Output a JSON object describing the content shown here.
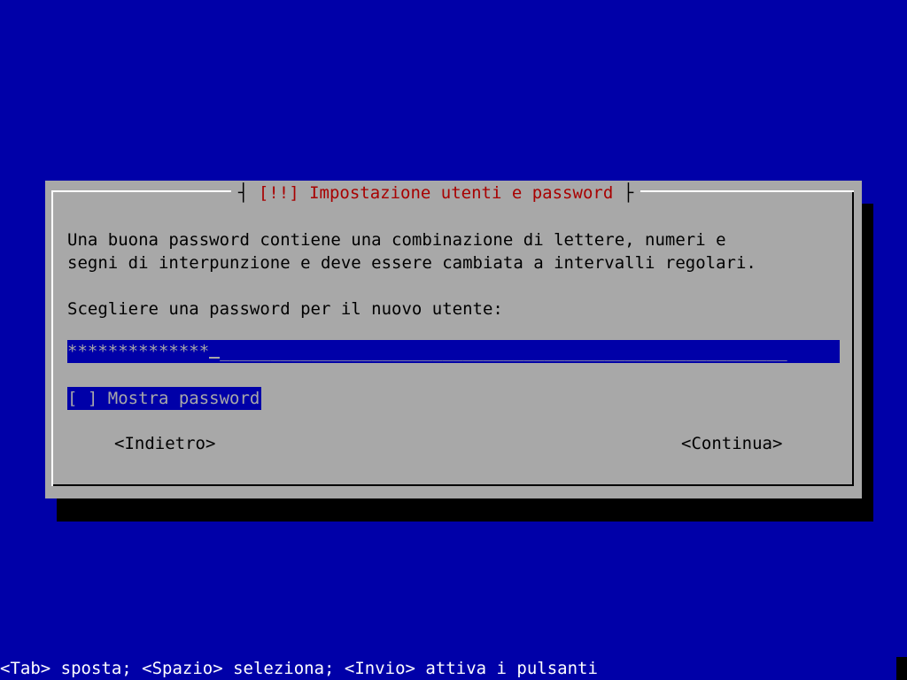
{
  "dialog": {
    "title": "[!!] Impostazione utenti e password",
    "description_line1": "Una buona password contiene una combinazione di lettere, numeri e",
    "description_line2": "segni di interpunzione e deve essere cambiata a intervalli regolari.",
    "prompt": "Scegliere una password per il nuovo utente:",
    "password_value": "**************",
    "password_fill": "________________________________________________________",
    "show_password_checkbox": "[ ]",
    "show_password_label": "Mostra password",
    "back_button": "<Indietro>",
    "continue_button": "<Continua>"
  },
  "status_bar": {
    "hint": "<Tab> sposta; <Spazio> seleziona; <Invio> attiva i pulsanti"
  },
  "colors": {
    "background": "#0000a8",
    "dialog": "#a8a8a8",
    "title": "#a80000",
    "text": "#000000",
    "status_text": "#ffffff"
  }
}
